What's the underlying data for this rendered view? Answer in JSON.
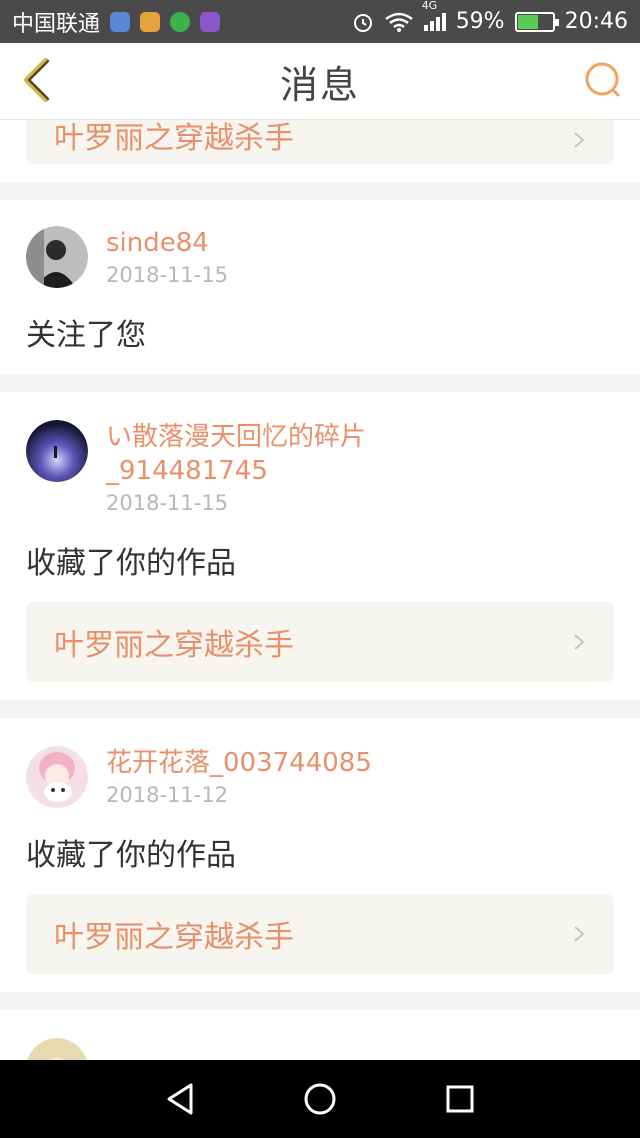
{
  "status_bar": {
    "carrier": "中国联通",
    "network": "4G",
    "battery_percent": "59%",
    "battery_level": 0.59,
    "time": "20:46"
  },
  "header": {
    "title": "消息",
    "back_icon": "back-chevron-icon",
    "search_icon": "search-icon"
  },
  "messages": [
    {
      "work_title": "叶罗丽之穿越杀手"
    },
    {
      "username": "sinde84",
      "date": "2018-11-15",
      "action": "关注了您"
    },
    {
      "username_line1": "い散落漫天回忆的碎片",
      "username_line2": "_914481745",
      "date": "2018-11-15",
      "action": "收藏了你的作品",
      "work_title": "叶罗丽之穿越杀手"
    },
    {
      "username": "花开花落_003744085",
      "date": "2018-11-12",
      "action": "收藏了你的作品",
      "work_title": "叶罗丽之穿越杀手"
    }
  ],
  "colors": {
    "accent": "#e9906a",
    "header_text": "#444444",
    "date": "#b7b7b7",
    "link_bg": "#f7f5ef"
  }
}
